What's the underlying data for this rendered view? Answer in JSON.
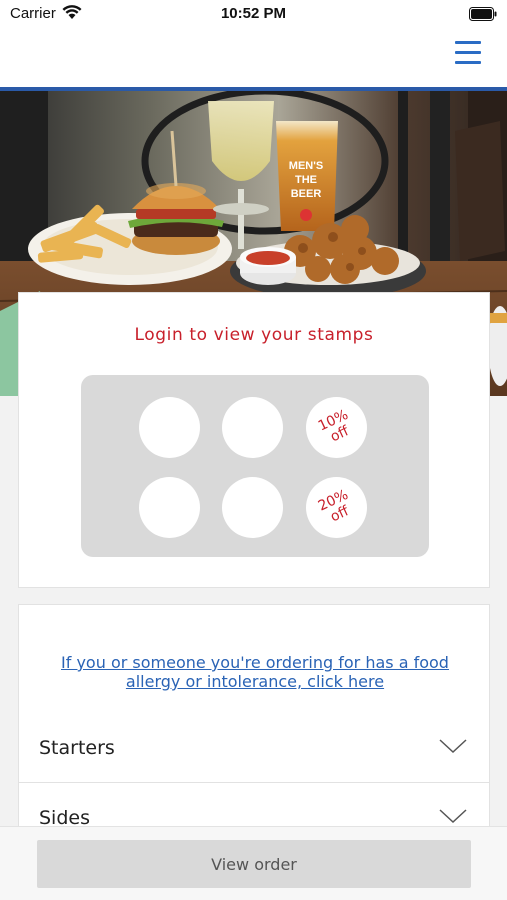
{
  "status_bar": {
    "carrier": "Carrier",
    "time": "10:52 PM",
    "wifi_icon": "wifi-icon",
    "battery_icon": "battery-icon"
  },
  "header": {
    "menu_icon": "hamburger-menu-icon",
    "accent_color": "#2a5aa8"
  },
  "hero": {
    "image": "food-and-drinks-photo",
    "glass_text": [
      "MEN'S",
      "THE",
      "BEER"
    ]
  },
  "stamps": {
    "title": "Login to view your stamps",
    "title_color": "#c8202b",
    "rewards": [
      {
        "line1": "10%",
        "line2": "off"
      },
      {
        "line1": "20%",
        "line2": "off"
      }
    ],
    "stamps_collected": 0
  },
  "allergy": {
    "link_text": "If you or someone you're ordering for has a food allergy or intolerance, click here",
    "link_color": "#2a63b5"
  },
  "menu_sections": [
    {
      "label": "Starters",
      "icon": "chevron-down-icon"
    },
    {
      "label": "Sides",
      "icon": "chevron-down-icon"
    }
  ],
  "footer": {
    "view_order_label": "View order"
  }
}
